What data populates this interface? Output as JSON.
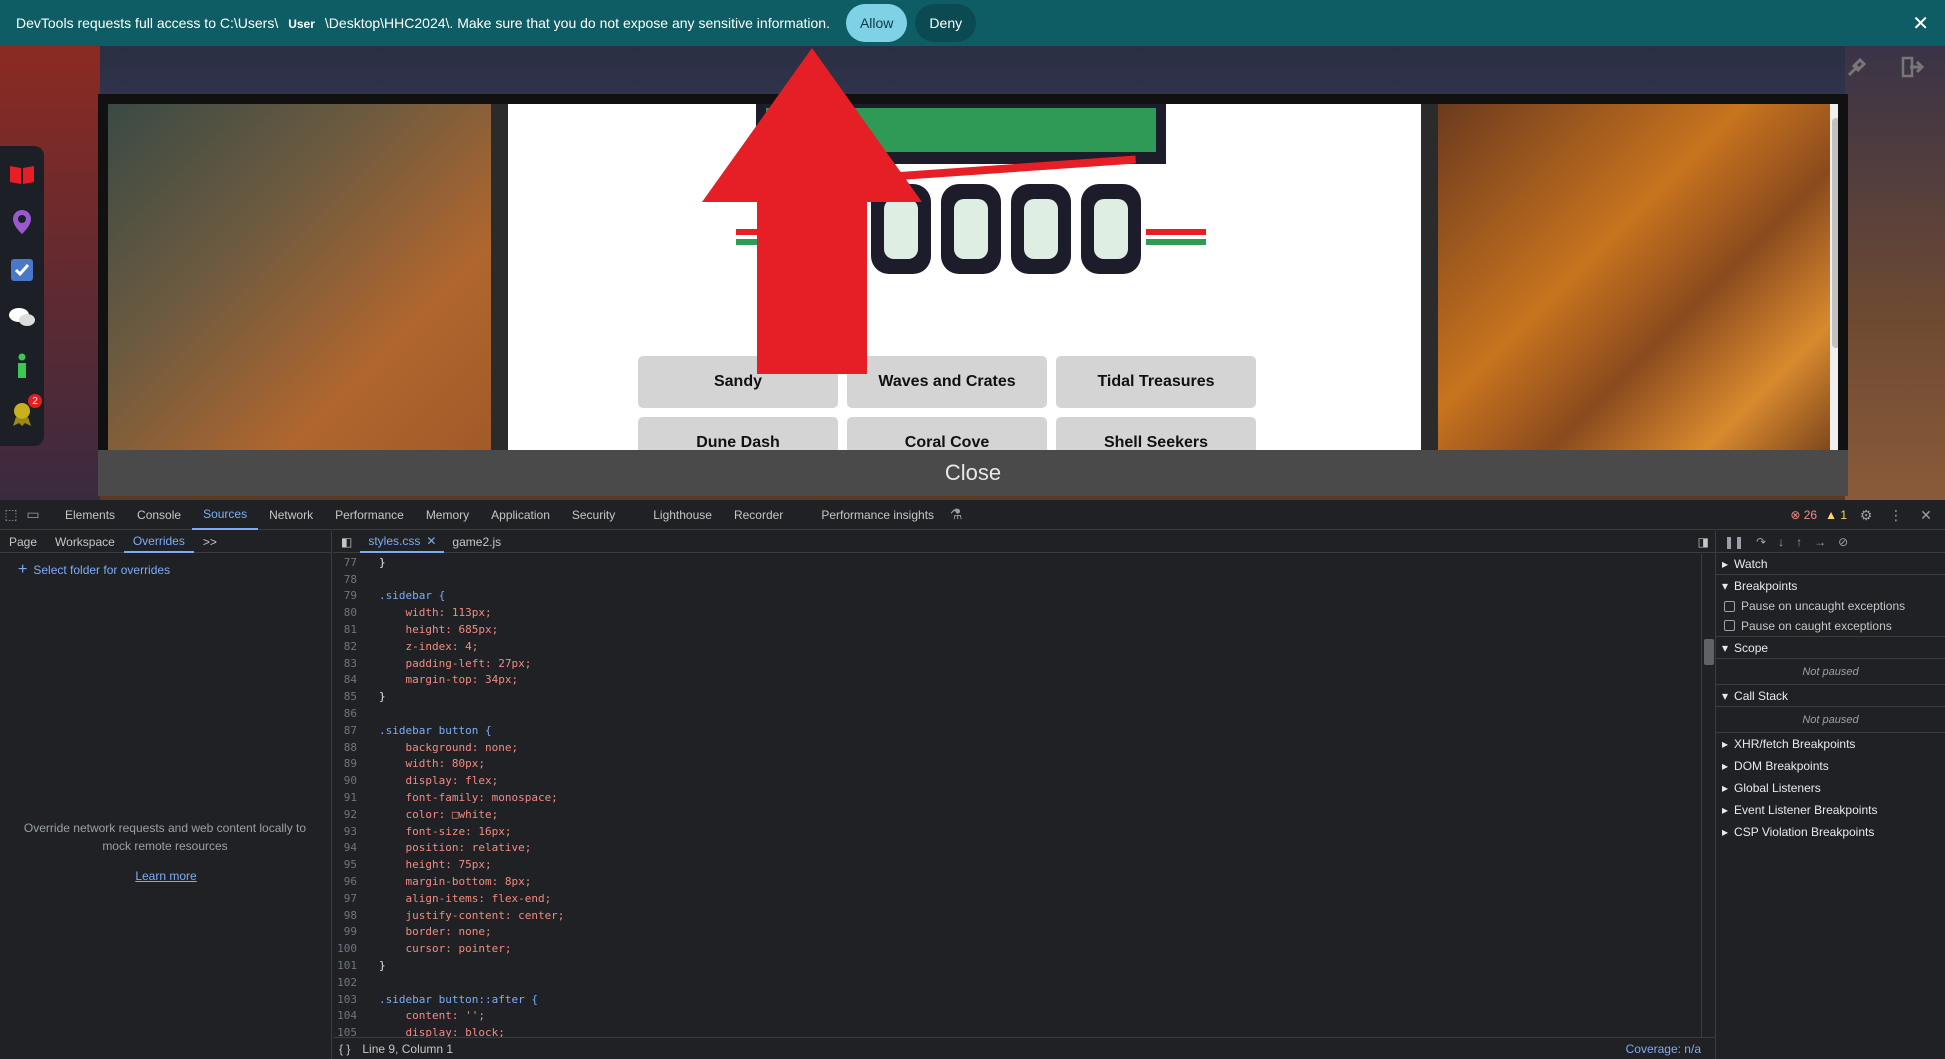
{
  "permission_bar": {
    "message_prefix": "DevTools requests full access to C:\\Users\\",
    "user": "User",
    "message_suffix": "\\Desktop\\HHC2024\\. Make sure that you do not expose any sensitive information.",
    "allow": "Allow",
    "deny": "Deny",
    "close": "✕"
  },
  "game": {
    "sidebar_badge": "2",
    "buttons": [
      "Sandy",
      "Waves and Crates",
      "Tidal Treasures",
      "Dune Dash",
      "Coral Cove",
      "Shell Seekers"
    ],
    "close_label": "Close"
  },
  "devtools": {
    "tabs": [
      "Elements",
      "Console",
      "Sources",
      "Network",
      "Performance",
      "Memory",
      "Application",
      "Security",
      "Lighthouse",
      "Recorder",
      "Performance insights"
    ],
    "active_tab": "Sources",
    "errors": "26",
    "warnings": "1",
    "nav_tabs": [
      "Page",
      "Workspace",
      "Overrides"
    ],
    "more": ">>",
    "select_folder": "Select folder for overrides",
    "empty_text": "Override network requests and web content locally to mock remote resources",
    "learn_more": "Learn more",
    "editor_tabs": [
      "styles.css",
      "game2.js"
    ],
    "status": "Line 9, Column 1",
    "coverage": "Coverage: n/a",
    "code_lines": [
      {
        "n": "77",
        "t": "}"
      },
      {
        "n": "78",
        "t": ""
      },
      {
        "n": "79",
        "t": ".sidebar {"
      },
      {
        "n": "80",
        "t": "    width: 113px;"
      },
      {
        "n": "81",
        "t": "    height: 685px;"
      },
      {
        "n": "82",
        "t": "    z-index: 4;"
      },
      {
        "n": "83",
        "t": "    padding-left: 27px;"
      },
      {
        "n": "84",
        "t": "    margin-top: 34px;"
      },
      {
        "n": "85",
        "t": "}"
      },
      {
        "n": "86",
        "t": ""
      },
      {
        "n": "87",
        "t": ".sidebar button {"
      },
      {
        "n": "88",
        "t": "    background: none;"
      },
      {
        "n": "89",
        "t": "    width: 80px;"
      },
      {
        "n": "90",
        "t": "    display: flex;"
      },
      {
        "n": "91",
        "t": "    font-family: monospace;"
      },
      {
        "n": "92",
        "t": "    color: □white;"
      },
      {
        "n": "93",
        "t": "    font-size: 16px;"
      },
      {
        "n": "94",
        "t": "    position: relative;"
      },
      {
        "n": "95",
        "t": "    height: 75px;"
      },
      {
        "n": "96",
        "t": "    margin-bottom: 8px;"
      },
      {
        "n": "97",
        "t": "    align-items: flex-end;"
      },
      {
        "n": "98",
        "t": "    justify-content: center;"
      },
      {
        "n": "99",
        "t": "    border: none;"
      },
      {
        "n": "100",
        "t": "    cursor: pointer;"
      },
      {
        "n": "101",
        "t": "}"
      },
      {
        "n": "102",
        "t": ""
      },
      {
        "n": "103",
        "t": ".sidebar button::after {"
      },
      {
        "n": "104",
        "t": "    content: '';"
      },
      {
        "n": "105",
        "t": "    display: block;"
      }
    ],
    "debugger": {
      "watch": "Watch",
      "breakpoints": "Breakpoints",
      "pause_uncaught": "Pause on uncaught exceptions",
      "pause_caught": "Pause on caught exceptions",
      "scope": "Scope",
      "not_paused_1": "Not paused",
      "call_stack": "Call Stack",
      "not_paused_2": "Not paused",
      "items": [
        "XHR/fetch Breakpoints",
        "DOM Breakpoints",
        "Global Listeners",
        "Event Listener Breakpoints",
        "CSP Violation Breakpoints"
      ]
    }
  },
  "colors": {
    "accent": "#7cacf8",
    "permission_bar": "#0e5c64",
    "arrow": "#e61e25"
  }
}
